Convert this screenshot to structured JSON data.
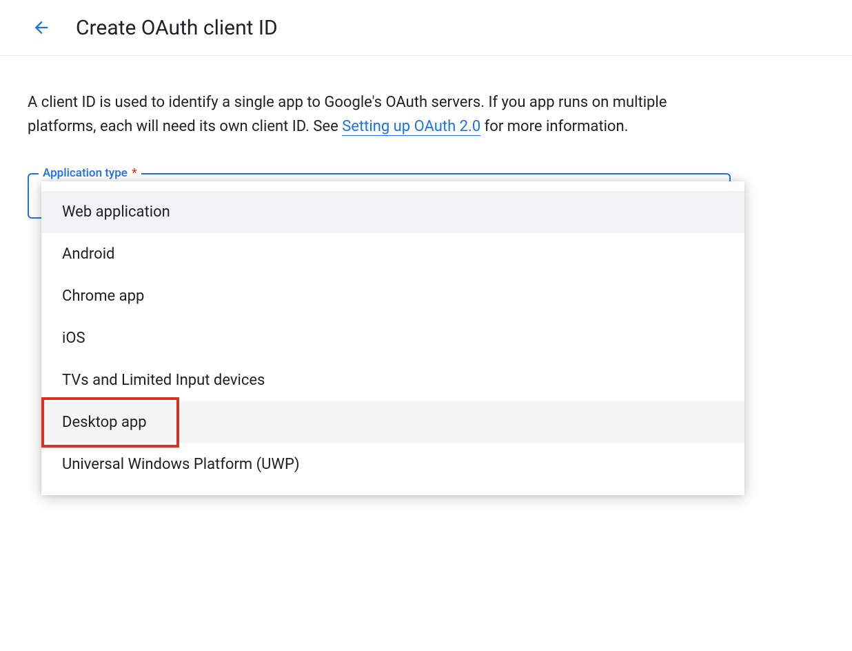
{
  "header": {
    "title": "Create OAuth client ID"
  },
  "description": {
    "text_before_link": "A client ID is used to identify a single app to Google's OAuth servers. If you app runs on multiple platforms, each will need its own client ID. See ",
    "link_text": "Setting up OAuth 2.0",
    "text_after_link": " for more information."
  },
  "select": {
    "label": "Application type",
    "required_indicator": "*"
  },
  "dropdown": {
    "options": [
      {
        "label": "Web application",
        "highlighted": true,
        "selected": false,
        "annotated": false
      },
      {
        "label": "Android",
        "highlighted": false,
        "selected": false,
        "annotated": false
      },
      {
        "label": "Chrome app",
        "highlighted": false,
        "selected": false,
        "annotated": false
      },
      {
        "label": "iOS",
        "highlighted": false,
        "selected": false,
        "annotated": false
      },
      {
        "label": "TVs and Limited Input devices",
        "highlighted": false,
        "selected": false,
        "annotated": false
      },
      {
        "label": "Desktop app",
        "highlighted": false,
        "selected": true,
        "annotated": true
      },
      {
        "label": "Universal Windows Platform (UWP)",
        "highlighted": false,
        "selected": false,
        "annotated": false
      }
    ]
  },
  "annotation": {
    "color": "#d93025"
  }
}
